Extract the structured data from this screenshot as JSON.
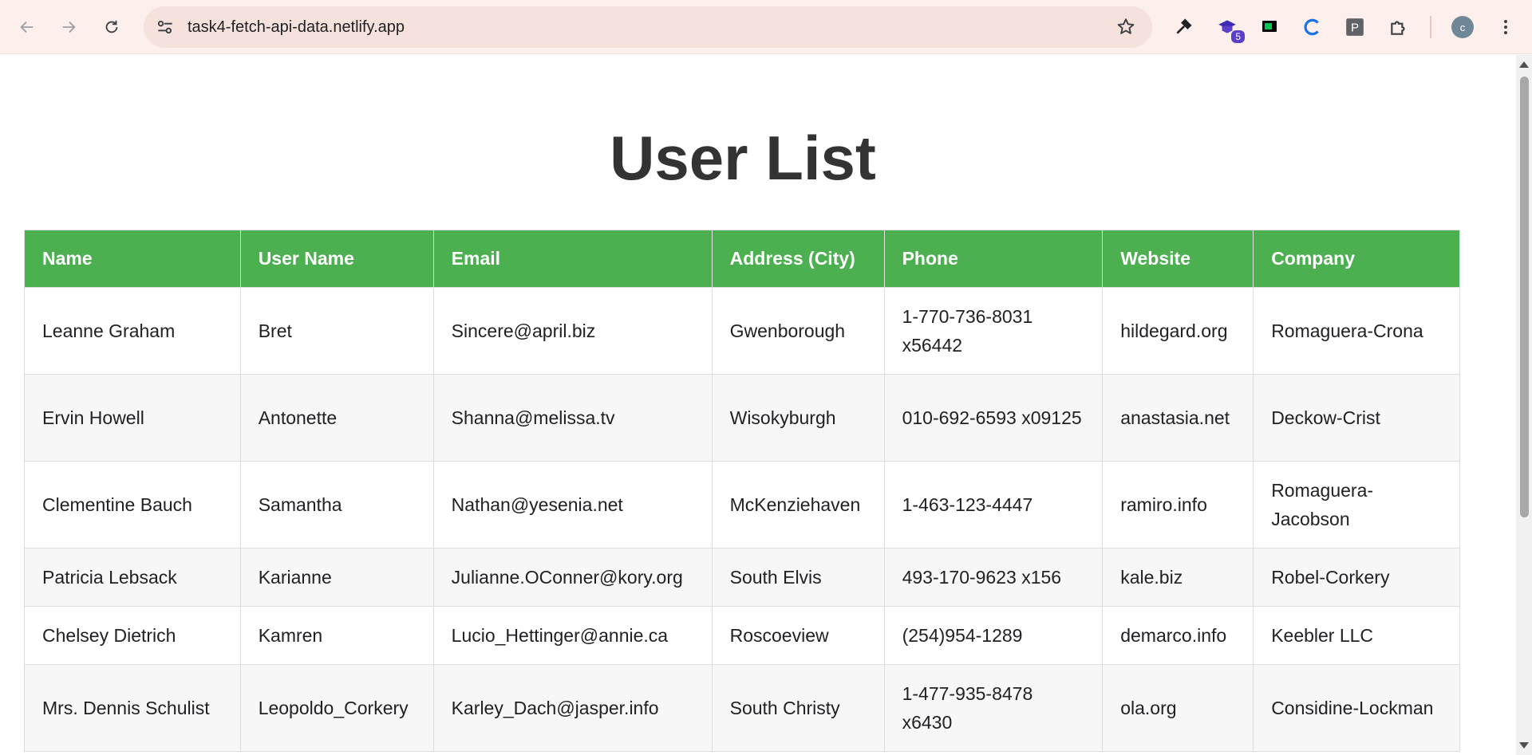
{
  "browser": {
    "url": "task4-fetch-api-data.netlify.app",
    "extension_badge": "5",
    "avatar_initial": "c"
  },
  "page": {
    "title": "User List"
  },
  "table": {
    "headers": [
      "Name",
      "User Name",
      "Email",
      "Address (City)",
      "Phone",
      "Website",
      "Company"
    ],
    "rows": [
      [
        "Leanne Graham",
        "Bret",
        "Sincere@april.biz",
        "Gwenborough",
        "1-770-736-8031 x56442",
        "hildegard.org",
        "Romaguera-Crona"
      ],
      [
        "Ervin Howell",
        "Antonette",
        "Shanna@melissa.tv",
        "Wisokyburgh",
        "010-692-6593 x09125",
        "anastasia.net",
        "Deckow-Crist"
      ],
      [
        "Clementine Bauch",
        "Samantha",
        "Nathan@yesenia.net",
        "McKenziehaven",
        "1-463-123-4447",
        "ramiro.info",
        "Romaguera-Jacobson"
      ],
      [
        "Patricia Lebsack",
        "Karianne",
        "Julianne.OConner@kory.org",
        "South Elvis",
        "493-170-9623 x156",
        "kale.biz",
        "Robel-Corkery"
      ],
      [
        "Chelsey Dietrich",
        "Kamren",
        "Lucio_Hettinger@annie.ca",
        "Roscoeview",
        "(254)954-1289",
        "demarco.info",
        "Keebler LLC"
      ],
      [
        "Mrs. Dennis Schulist",
        "Leopoldo_Corkery",
        "Karley_Dach@jasper.info",
        "South Christy",
        "1-477-935-8478 x6430",
        "ola.org",
        "Considine-Lockman"
      ]
    ]
  },
  "colors": {
    "header_bg": "#4caf50",
    "title": "#333333",
    "chrome_bg": "#fdf0ec"
  }
}
